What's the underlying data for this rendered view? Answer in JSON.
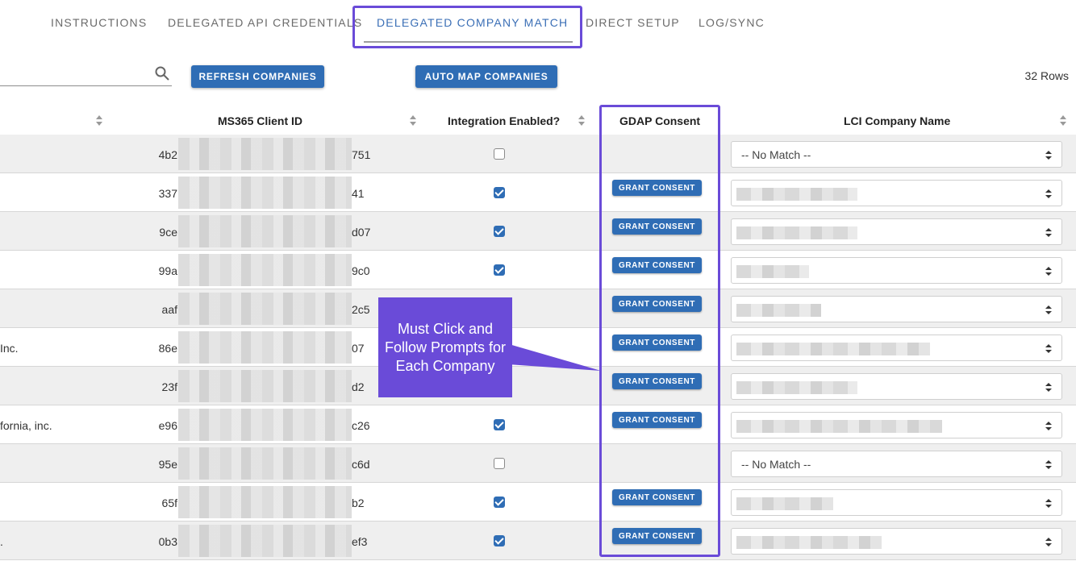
{
  "tabs": [
    {
      "label": "INSTRUCTIONS"
    },
    {
      "label": "DELEGATED API CREDENTIALS"
    },
    {
      "label": "DELEGATED COMPANY MATCH"
    },
    {
      "label": "DIRECT SETUP"
    },
    {
      "label": "LOG/SYNC"
    }
  ],
  "toolbar": {
    "refresh_label": "REFRESH COMPANIES",
    "automap_label": "AUTO MAP COMPANIES",
    "rows_count": "32 Rows"
  },
  "table": {
    "headers": {
      "client_id": "MS365 Client ID",
      "integration": "Integration Enabled?",
      "gdap": "GDAP Consent",
      "lci": "LCI Company Name"
    },
    "grant_label": "GRANT CONSENT",
    "rows": [
      {
        "name": "",
        "id_prefix": "4b2",
        "id_suffix": "751",
        "enabled": false,
        "consent": false,
        "lci": "-- No Match --"
      },
      {
        "name": "",
        "id_prefix": "337",
        "id_suffix": "41",
        "enabled": true,
        "consent": true,
        "lci": ""
      },
      {
        "name": "",
        "id_prefix": "9ce",
        "id_suffix": "d07",
        "enabled": true,
        "consent": true,
        "lci": ""
      },
      {
        "name": "",
        "id_prefix": "99a",
        "id_suffix": "9c0",
        "enabled": true,
        "consent": true,
        "lci": ""
      },
      {
        "name": "",
        "id_prefix": "aaf",
        "id_suffix": "2c5",
        "enabled": true,
        "consent": true,
        "lci": ""
      },
      {
        "name": "Inc.",
        "id_prefix": "86e",
        "id_suffix": "07",
        "enabled": true,
        "consent": true,
        "lci": ""
      },
      {
        "name": "",
        "id_prefix": "23f",
        "id_suffix": "d2",
        "enabled": true,
        "consent": true,
        "lci": ""
      },
      {
        "name": "fornia, inc.",
        "id_prefix": "e96",
        "id_suffix": "c26",
        "enabled": true,
        "consent": true,
        "lci": ""
      },
      {
        "name": "",
        "id_prefix": "95e",
        "id_suffix": "c6d",
        "enabled": false,
        "consent": false,
        "lci": "-- No Match --"
      },
      {
        "name": "",
        "id_prefix": "65f",
        "id_suffix": "b2",
        "enabled": true,
        "consent": true,
        "lci": ""
      },
      {
        "name": ".",
        "id_prefix": "0b3",
        "id_suffix": "ef3",
        "enabled": true,
        "consent": true,
        "lci": ""
      }
    ]
  },
  "callout": {
    "text": "Must Click and Follow Prompts for Each Company"
  },
  "colors": {
    "accent": "#2f6db5",
    "highlight": "#6a4bd8",
    "active_tab": "#3b6fb6"
  },
  "icons": {
    "search": "search-icon"
  }
}
